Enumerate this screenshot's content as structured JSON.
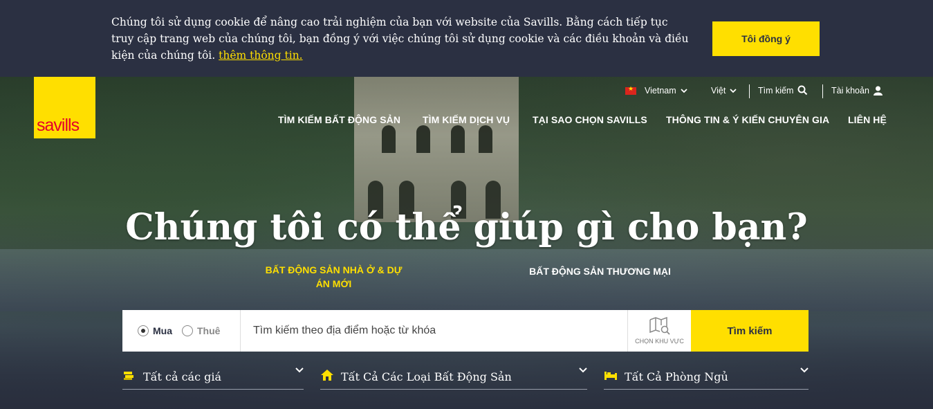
{
  "cookie_banner": {
    "text": "Chúng tôi sử dụng cookie để nâng cao trải nghiệm của bạn với website của Savills. Bằng cách tiếp tục truy cập trang web của chúng tôi, bạn đồng ý với việc chúng tôi sử dụng cookie và các điều khoản và điều kiện của chúng tôi.",
    "link_label": "thêm thông tin.",
    "accept_label": "Tôi đồng ý"
  },
  "logo": {
    "text": "savills"
  },
  "utility": {
    "country": "Vietnam",
    "language": "Việt",
    "search_label": "Tìm kiếm",
    "account_label": "Tài khoản"
  },
  "nav": {
    "items": [
      "TÌM KIẾM BẤT ĐỘNG SẢN",
      "TÌM KIẾM DỊCH VỤ",
      "TẠI SAO CHỌN SAVILLS",
      "THÔNG TIN & Ý KIẾN CHUYÊN GIA",
      "LIÊN HỆ"
    ]
  },
  "hero": {
    "headline": "Chúng tôi có thể giúp gì cho bạn?",
    "tabs": [
      {
        "label": "BẤT ĐỘNG SẢN NHÀ Ở & DỰ ÁN MỚI",
        "active": true
      },
      {
        "label": "BẤT ĐỘNG SẢN THƯƠNG MẠI",
        "active": false
      }
    ]
  },
  "search": {
    "buy_label": "Mua",
    "rent_label": "Thuê",
    "selected": "Mua",
    "placeholder": "Tìm kiếm theo địa điểm hoặc từ khóa",
    "map_label": "CHỌN KHU VỰC",
    "submit_label": "Tìm kiếm"
  },
  "filters": [
    {
      "label": "Tất cả các giá",
      "icon": "money-icon"
    },
    {
      "label": "Tất Cả Các Loại Bất Động Sản",
      "icon": "home-icon"
    },
    {
      "label": "Tất Cả Phòng Ngủ",
      "icon": "bed-icon"
    }
  ],
  "colors": {
    "brand_yellow": "#ffdf00",
    "brand_red": "#e4002b",
    "navy": "#2b3042"
  }
}
